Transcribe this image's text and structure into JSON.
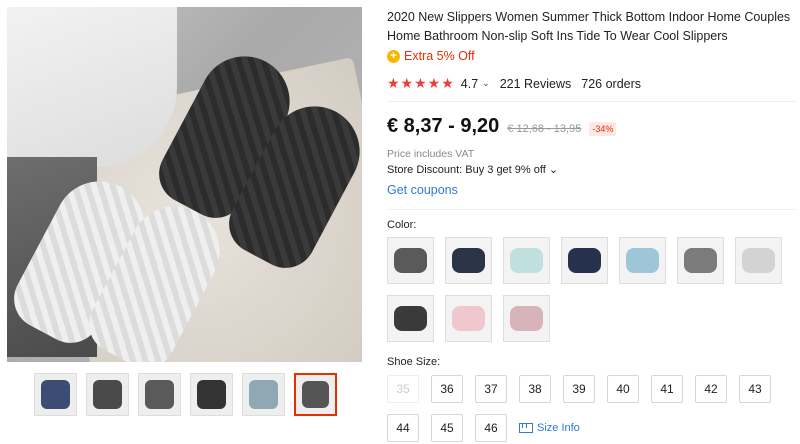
{
  "product": {
    "title": "2020 New Slippers Women Summer Thick Bottom Indoor Home Couples Home Bathroom Non-slip Soft Ins Tide To Wear Cool Slippers",
    "promo": {
      "icon": "plus-circle-icon",
      "text": "Extra 5% Off",
      "icon_glyph": "+"
    },
    "rating": {
      "stars_glyph": "★★★★★",
      "value": "4.7",
      "reviews": "221 Reviews",
      "orders": "726 orders",
      "chevron": "⌄"
    },
    "price": {
      "current": "€ 8,37 - 9,20",
      "original": "€ 12,68 - 13,95",
      "discount": "-34%"
    },
    "vat_note": "Price includes VAT",
    "store_discount": "Store Discount: Buy 3 get 9% off ⌄",
    "coupons_link": "Get coupons",
    "color_label": "Color:",
    "size_label": "Shoe Size:",
    "size_info": "Size Info",
    "sizes": [
      {
        "label": "35",
        "available": false
      },
      {
        "label": "36",
        "available": true
      },
      {
        "label": "37",
        "available": true
      },
      {
        "label": "38",
        "available": true
      },
      {
        "label": "39",
        "available": true
      },
      {
        "label": "40",
        "available": true
      },
      {
        "label": "41",
        "available": true
      },
      {
        "label": "42",
        "available": true
      },
      {
        "label": "43",
        "available": true
      },
      {
        "label": "44",
        "available": true
      },
      {
        "label": "45",
        "available": true
      },
      {
        "label": "46",
        "available": true
      }
    ],
    "colors": [
      "#5a5a5a",
      "#2b3346",
      "#bfe0df",
      "#26324d",
      "#9fc5d8",
      "#7b7b7b",
      "#d3d3d3",
      "#3a3a3a",
      "#efc7cc",
      "#d9b3ba"
    ]
  },
  "gallery": {
    "thumb_count": 6,
    "active_index": 5,
    "thumb_colors": [
      "#3b4d73",
      "#4a4a4a",
      "#5a5a5a",
      "#333333",
      "#8fa8b3",
      "#555555"
    ]
  },
  "theme": {
    "accent": "#e62e04",
    "link": "#2e7bd6",
    "star": "#f23c3c"
  }
}
